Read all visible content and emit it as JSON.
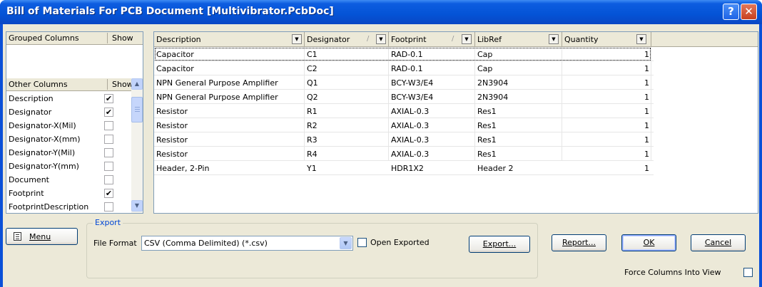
{
  "window": {
    "title": "Bill of Materials For PCB Document [Multivibrator.PcbDoc]",
    "help_label": "?",
    "close_label": "✕"
  },
  "grouped_columns": {
    "header": "Grouped Columns",
    "show_header": "Show"
  },
  "other_columns": {
    "header": "Other Columns",
    "show_header": "Show",
    "items": [
      {
        "label": "Description",
        "checked": true
      },
      {
        "label": "Designator",
        "checked": true
      },
      {
        "label": "Designator-X(Mil)",
        "checked": false
      },
      {
        "label": "Designator-X(mm)",
        "checked": false
      },
      {
        "label": "Designator-Y(Mil)",
        "checked": false
      },
      {
        "label": "Designator-Y(mm)",
        "checked": false
      },
      {
        "label": "Document",
        "checked": false
      },
      {
        "label": "Footprint",
        "checked": true
      },
      {
        "label": "FootprintDescription",
        "checked": false
      }
    ]
  },
  "grid": {
    "columns": [
      "Description",
      "Designator",
      "Footprint",
      "LibRef",
      "Quantity"
    ],
    "rows": [
      [
        "Capacitor",
        "C1",
        "RAD-0.1",
        "Cap",
        "1"
      ],
      [
        "Capacitor",
        "C2",
        "RAD-0.1",
        "Cap",
        "1"
      ],
      [
        "NPN General Purpose Amplifier",
        "Q1",
        "BCY-W3/E4",
        "2N3904",
        "1"
      ],
      [
        "NPN General Purpose Amplifier",
        "Q2",
        "BCY-W3/E4",
        "2N3904",
        "1"
      ],
      [
        "Resistor",
        "R1",
        "AXIAL-0.3",
        "Res1",
        "1"
      ],
      [
        "Resistor",
        "R2",
        "AXIAL-0.3",
        "Res1",
        "1"
      ],
      [
        "Resistor",
        "R3",
        "AXIAL-0.3",
        "Res1",
        "1"
      ],
      [
        "Resistor",
        "R4",
        "AXIAL-0.3",
        "Res1",
        "1"
      ],
      [
        "Header, 2-Pin",
        "Y1",
        "HDR1X2",
        "Header 2",
        "1"
      ]
    ]
  },
  "bottom": {
    "menu_label": "Menu",
    "export_group_label": "Export",
    "file_format_label": "File Format",
    "file_format_value": "CSV (Comma Delimited) (*.csv)",
    "open_exported_label": "Open Exported",
    "open_exported_checked": false,
    "export_button": "Export...",
    "report_button": "Report...",
    "ok_button": "OK",
    "cancel_button": "Cancel",
    "force_columns_label": "Force Columns Into View",
    "force_columns_checked": false
  }
}
